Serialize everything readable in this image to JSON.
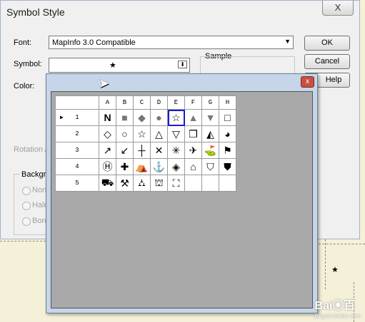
{
  "dialog": {
    "title": "Symbol Style",
    "close_label": "X",
    "font_label": "Font:",
    "font_value": "MapInfo 3.0 Compatible",
    "symbol_label": "Symbol:",
    "symbol_value": "★",
    "color_label": "Color:",
    "sample_label": "Sample",
    "rotation_label": "Rotation A",
    "background_label": "Backgro",
    "radio_none": "None",
    "radio_halo": "Halo",
    "radio_border": "Bord",
    "ok_label": "OK",
    "cancel_label": "Cancel",
    "help_label": "Help"
  },
  "popup": {
    "close_label": "x",
    "row_marker": "▶",
    "columns": [
      "A",
      "B",
      "C",
      "D",
      "E",
      "F",
      "G",
      "H"
    ],
    "rows": [
      {
        "label": "1",
        "cells": [
          "N",
          "■",
          "◆",
          "●",
          "☆",
          "▲",
          "▼",
          "□"
        ]
      },
      {
        "label": "2",
        "cells": [
          "◇",
          "○",
          "☆",
          "△",
          "▽",
          "❒",
          "◭",
          "◕"
        ]
      },
      {
        "label": "3",
        "cells": [
          "↗",
          "↙",
          "┼",
          "✕",
          "✳",
          "✈",
          "⛳",
          "⚑"
        ]
      },
      {
        "label": "4",
        "cells": [
          "Ⓗ",
          "✚",
          "⛺",
          "⚓",
          "◈",
          "⌂",
          "⛉",
          "⛊"
        ]
      },
      {
        "label": "5",
        "cells": [
          "⛟",
          "⚒",
          "⛼",
          "⛫",
          "⛶",
          "",
          "",
          ""
        ]
      }
    ],
    "selected_row": 0,
    "selected_col": 4
  },
  "watermark": {
    "brand": "Bai⦿百",
    "sub": "jingyan.baidu.com"
  }
}
